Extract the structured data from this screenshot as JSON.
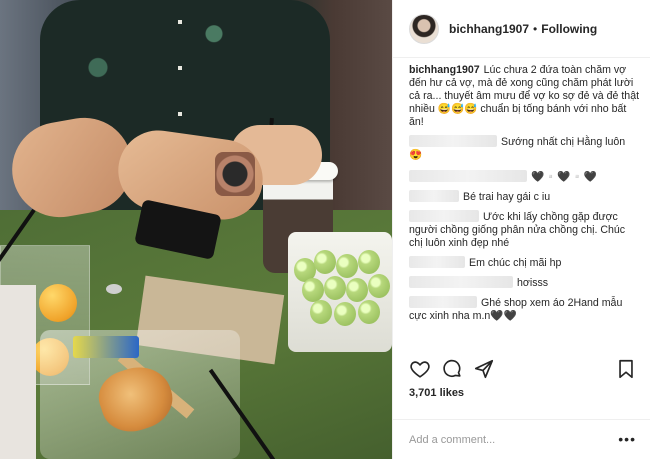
{
  "header": {
    "username": "bichhang1907",
    "separator": "•",
    "follow_status": "Following"
  },
  "caption": {
    "username": "bichhang1907",
    "text": "Lúc chưa 2 đứa toàn chăm vợ đến hư cả vợ, mà đẻ xong cũng chăm phát lười cả ra... thuyết âm mưu để vợ ko sợ đẻ và đẻ thật nhiều 😅😅😅 chuẩn bị tống bánh với nho bất ăn!"
  },
  "comments": [
    {
      "text": "Sướng nhất chị Hằng luôn 😍"
    },
    {
      "text": "🖤▫️🖤▫️🖤"
    },
    {
      "text": "Bé trai hay gái c iu"
    },
    {
      "text": "Ước khi lấy chồng gặp được người chồng giống phân nửa chồng chị. Chúc chị luôn xinh đẹp nhé"
    },
    {
      "text": "Em chúc chị mãi hp"
    },
    {
      "text": "hơisss"
    },
    {
      "text": "Ghé shop xem áo 2Hand mẫu cực xinh nha m.n🖤🖤"
    }
  ],
  "actions": {
    "like_icon": "heart-icon",
    "comment_icon": "comment-icon",
    "share_icon": "share-icon",
    "save_icon": "bookmark-icon"
  },
  "likes": "3,701 likes",
  "add_comment": {
    "placeholder": "Add a comment...",
    "more_label": "•••"
  }
}
